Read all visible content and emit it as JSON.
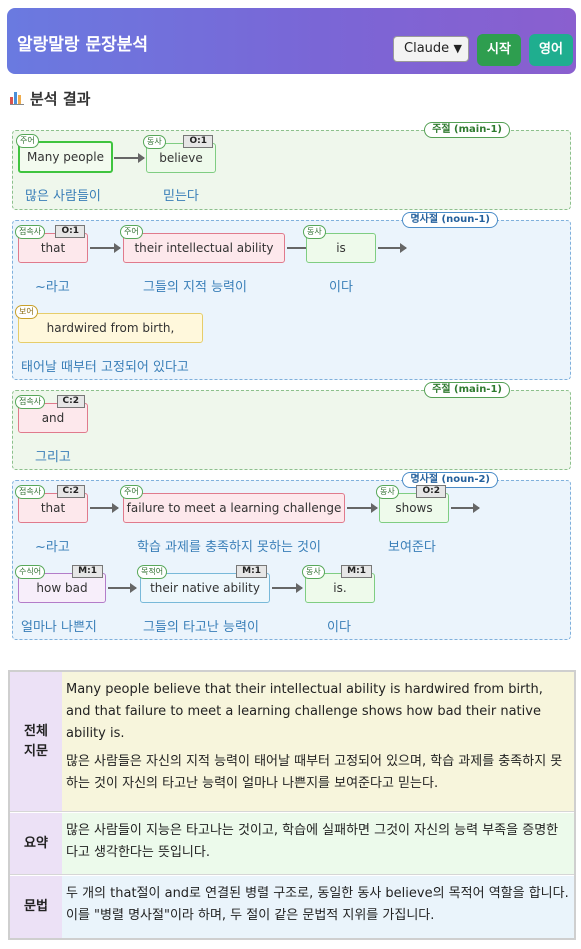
{
  "header": {
    "title": "알랑말랑 문장분석",
    "model": "Claude",
    "start_label": "시작",
    "english_label": "영어"
  },
  "section_title": "분석 결과",
  "clauses": [
    {
      "tag": "주절 (main-1)",
      "words": [
        {
          "role": "주어",
          "text": "Many people",
          "code": "",
          "ko": "많은 사람들이"
        },
        {
          "role": "동사",
          "text": "believe",
          "code": "O:1",
          "ko": "믿는다"
        }
      ]
    },
    {
      "tag": "명사절 (noun-1)",
      "words": [
        {
          "role": "접속사",
          "text": "that",
          "code": "O:1",
          "ko": "~라고"
        },
        {
          "role": "주어",
          "text": "their intellectual ability",
          "code": "",
          "ko": "그들의 지적 능력이"
        },
        {
          "role": "동사",
          "text": "is",
          "code": "",
          "ko": "이다"
        },
        {
          "role": "보어",
          "text": "hardwired from birth,",
          "code": "",
          "ko": "태어날 때부터 고정되어 있다고"
        }
      ]
    },
    {
      "tag": "주절 (main-1)",
      "words": [
        {
          "role": "접속사",
          "text": "and",
          "code": "C:2",
          "ko": "그리고"
        }
      ]
    },
    {
      "tag": "명사절 (noun-2)",
      "words": [
        {
          "role": "접속사",
          "text": "that",
          "code": "C:2",
          "ko": "~라고"
        },
        {
          "role": "주어",
          "text": "failure to meet a learning challenge",
          "code": "",
          "ko": "학습 과제를 충족하지 못하는 것이"
        },
        {
          "role": "동사",
          "text": "shows",
          "code": "O:2",
          "ko": "보여준다"
        },
        {
          "role": "수식어",
          "text": "how bad",
          "code": "M:1",
          "ko": "얼마나 나쁜지"
        },
        {
          "role": "목적어",
          "text": "their native ability",
          "code": "M:1",
          "ko": "그들의 타고난 능력이"
        },
        {
          "role": "동사",
          "text": "is.",
          "code": "M:1",
          "ko": "이다"
        }
      ]
    }
  ],
  "summary_table": {
    "full_label": "전체 지문",
    "full_en": "Many people believe that their intellectual ability is hardwired from birth, and that failure to meet a learning challenge shows how bad their native ability is.",
    "full_ko": "많은 사람들은 자신의 지적 능력이 태어날 때부터 고정되어 있으며, 학습 과제를 충족하지 못하는 것이 자신의 타고난 능력이 얼마나 나쁜지를 보여준다고 믿는다.",
    "summary_label": "요약",
    "summary": "많은 사람들이 지능은 타고나는 것이고, 학습에 실패하면 그것이 자신의 능력 부족을 증명한다고 생각한다는 뜻입니다.",
    "grammar_label": "문법",
    "grammar": "두 개의 that절이 and로 연결된 병렬 구조로, 동일한 동사 believe의 목적어 역할을 합니다. 이를 \"병렬 명사절\"이라 하며, 두 절이 같은 문법적 지위를 가집니다."
  },
  "colors": {
    "header_gradient": [
      "#6a7ae0",
      "#8a5fcf"
    ],
    "start_button": "#2e9e4f",
    "english_button": "#1fae8f",
    "main_clause_bg": "#eff7ec",
    "noun_clause_bg": "#ebf4fc",
    "translation_text": "#3a7fb8"
  },
  "icons": {
    "section": "bar-chart-icon",
    "select": "chevron-down-icon"
  }
}
